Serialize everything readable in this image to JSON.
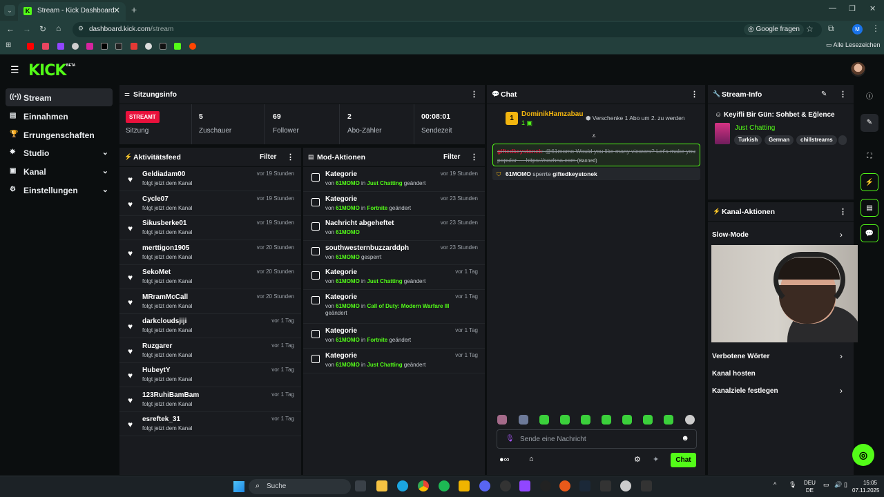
{
  "browser": {
    "tab_title": "Stream - Kick Dashboard",
    "url_host": "dashboard.kick.com",
    "url_path": "/stream",
    "google_btn": "Google fragen",
    "profile_initial": "M",
    "bookmarks_all": "Alle Lesezeichen"
  },
  "app": {
    "logo": "KICK",
    "beta": "BETA"
  },
  "sidebar": {
    "items": [
      {
        "label": "Stream",
        "icon": "broadcast-icon"
      },
      {
        "label": "Einnahmen",
        "icon": "money-icon"
      },
      {
        "label": "Errungenschaften",
        "icon": "trophy-icon"
      },
      {
        "label": "Studio",
        "icon": "studio-icon"
      },
      {
        "label": "Kanal",
        "icon": "channel-icon"
      },
      {
        "label": "Einstellungen",
        "icon": "gear-icon"
      }
    ]
  },
  "session": {
    "title": "Sitzungsinfo",
    "badge": "STREAMT",
    "session_label": "Sitzung",
    "viewers": "5",
    "viewers_label": "Zuschauer",
    "followers": "69",
    "followers_label": "Follower",
    "subs": "2",
    "subs_label": "Abo-Zähler",
    "time": "00:08:01",
    "time_label": "Sendezeit"
  },
  "activity": {
    "title": "Aktivitätsfeed",
    "filter": "Filter",
    "items": [
      {
        "name": "Geldiadam00",
        "sub": "folgt jetzt dem Kanal",
        "time": "vor 19 Stunden"
      },
      {
        "name": "Cycle07",
        "sub": "folgt jetzt dem Kanal",
        "time": "vor 19 Stunden"
      },
      {
        "name": "Sikusberke01",
        "sub": "folgt jetzt dem Kanal",
        "time": "vor 19 Stunden"
      },
      {
        "name": "merttigon1905",
        "sub": "folgt jetzt dem Kanal",
        "time": "vor 20 Stunden"
      },
      {
        "name": "SekoMet",
        "sub": "folgt jetzt dem Kanal",
        "time": "vor 20 Stunden"
      },
      {
        "name": "MRramMcCall",
        "sub": "folgt jetzt dem Kanal",
        "time": "vor 20 Stunden"
      },
      {
        "name": "darkcloudsjiji",
        "sub": "folgt jetzt dem Kanal",
        "time": "vor 1 Tag"
      },
      {
        "name": "Ruzgarer",
        "sub": "folgt jetzt dem Kanal",
        "time": "vor 1 Tag"
      },
      {
        "name": "HubeytY",
        "sub": "folgt jetzt dem Kanal",
        "time": "vor 1 Tag"
      },
      {
        "name": "123RuhiBamBam",
        "sub": "folgt jetzt dem Kanal",
        "time": "vor 1 Tag"
      },
      {
        "name": "esreftek_31",
        "sub": "folgt jetzt dem Kanal",
        "time": "vor 1 Tag"
      }
    ]
  },
  "mod": {
    "title": "Mod-Aktionen",
    "filter": "Filter",
    "items": [
      {
        "name": "Kategorie",
        "pre": "von ",
        "user": "61MOMO",
        "mid": " in ",
        "target": "Just Chatting",
        "post": " geändert",
        "time": "vor 19 Stunden"
      },
      {
        "name": "Kategorie",
        "pre": "von ",
        "user": "61MOMO",
        "mid": " in ",
        "target": "Fortnite",
        "post": " geändert",
        "time": "vor 23 Stunden"
      },
      {
        "name": "Nachricht abgeheftet",
        "pre": "von ",
        "user": "61MOMO",
        "mid": "",
        "target": "",
        "post": "",
        "time": "vor 23 Stunden"
      },
      {
        "name": "southwesternbuzzarddph",
        "pre": "von ",
        "user": "61MOMO",
        "mid": "",
        "target": "",
        "post": " gesperrt",
        "time": "vor 23 Stunden"
      },
      {
        "name": "Kategorie",
        "pre": "von ",
        "user": "61MOMO",
        "mid": " in ",
        "target": "Just Chatting",
        "post": " geändert",
        "time": "vor 1 Tag"
      },
      {
        "name": "Kategorie",
        "pre": "von ",
        "user": "61MOMO",
        "mid": " in ",
        "target": "Call of Duty: Modern Warfare III",
        "post": " geändert",
        "time": "vor 1 Tag"
      },
      {
        "name": "Kategorie",
        "pre": "von ",
        "user": "61MOMO",
        "mid": " in ",
        "target": "Fortnite",
        "post": " geändert",
        "time": "vor 1 Tag"
      },
      {
        "name": "Kategorie",
        "pre": "von ",
        "user": "61MOMO",
        "mid": " in ",
        "target": "Just Chatting",
        "post": " geändert",
        "time": "vor 1 Tag"
      }
    ]
  },
  "chat": {
    "title": "Chat",
    "gift_user": "DominikHamzabau",
    "gift_count": "1",
    "gift_text": "Verschenke 1 Abo um 2. zu werden",
    "msg_user": "giftedkeystonek",
    "msg_text": "@61momo Would you like many viewers? Let's make you popular --- https://nezhna.com",
    "msg_banned": "(Banned)",
    "ban_user": "61MOMO",
    "ban_verb": "sperrte",
    "ban_target": "giftedkeystonek",
    "input_placeholder": "Sende eine Nachricht",
    "send": "Chat"
  },
  "stream_info": {
    "title": "Stream-Info",
    "stream_title": "Keyifli Bir Gün: Sohbet & Eğlence",
    "category": "Just Chatting",
    "tags": [
      "Turkish",
      "German",
      "chillstreams"
    ]
  },
  "channel_actions": {
    "title": "Kanal-Aktionen",
    "slow_mode": "Slow-Mode",
    "banned_words": "Verbotene Wörter",
    "host": "Kanal hosten",
    "goals": "Kanalziele festlegen"
  },
  "taskbar": {
    "search": "Suche",
    "lang1": "DEU",
    "lang2": "DE",
    "time": "15:05",
    "date": "07.11.2025"
  }
}
